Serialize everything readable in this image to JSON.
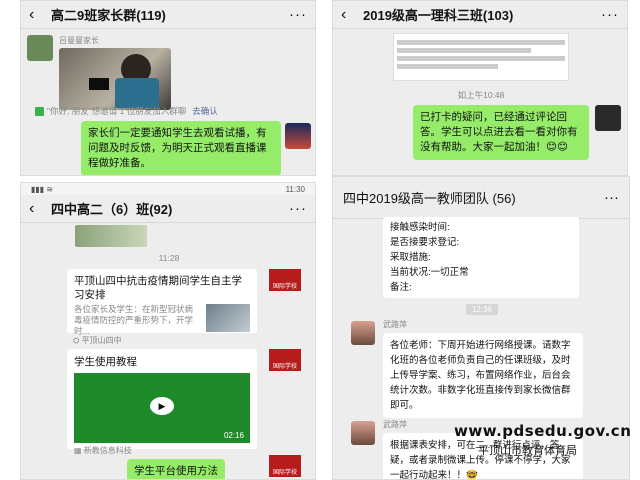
{
  "panel1": {
    "title": "高二9班家长群(119)",
    "sender_name": "吕曼曼家长",
    "sys_note": "\"你好, 朋友\"想邀请 1 位朋友加入群聊",
    "sys_link": "去确认",
    "message": "家长们一定要通知学生去观看试播，有问题及时反馈，为明天正式观看直播课程做好准备。"
  },
  "panel2": {
    "title": "2019级高一理科三班(103)",
    "time": "如上午10:48",
    "message": "已打卡的疑问，已经通过评论回答。学生可以点进去看一看对你有没有帮助。大家一起加油！😊😊"
  },
  "panel3": {
    "status_time": "11:30",
    "title": "四中高二（6）班(92)",
    "time": "11:28",
    "card1_title": "平顶山四中抗击疫情期间学生自主学习安排",
    "card1_desc": "各位家长及学生：在新型冠状病毒疫情防控的严重形势下，开学时...",
    "card1_source": "平顶山四中",
    "card2_title": "学生使用教程",
    "card2_duration": "02:16",
    "card2_source": "新教信息科技",
    "bubble": "学生平台使用方法",
    "avatar_tag": "国际学校"
  },
  "panel4": {
    "title": "四中2019级高一教师团队 (56)",
    "top_lines": [
      "接触感染时间:",
      "是否接要求登记:",
      "采取措施:",
      "当前状况:一切正常",
      "备注:"
    ],
    "time": "12:36",
    "sender1": "武路萍",
    "message1": "各位老师：下周开始进行网络授课。请数字化班的各位老师负责自己的任课班级，及时上传导学案、练习，布置网络作业，后台会统计次数。非数字化班直接传到家长微信群即可。",
    "sender2": "武路萍",
    "message2": "根据课表安排，可在二...群进行点评，答疑，或者录制微课上传。停课不停学，大家一起行动起来！！🤓"
  },
  "watermark": {
    "url": "www.pdsedu.gov.cn",
    "org": "平顶山市教育体育局"
  },
  "colors": {
    "bubble_green": "#95ec69",
    "chat_bg": "#ededed",
    "link_blue": "#576b95",
    "video_green": "#1f8a2a"
  }
}
